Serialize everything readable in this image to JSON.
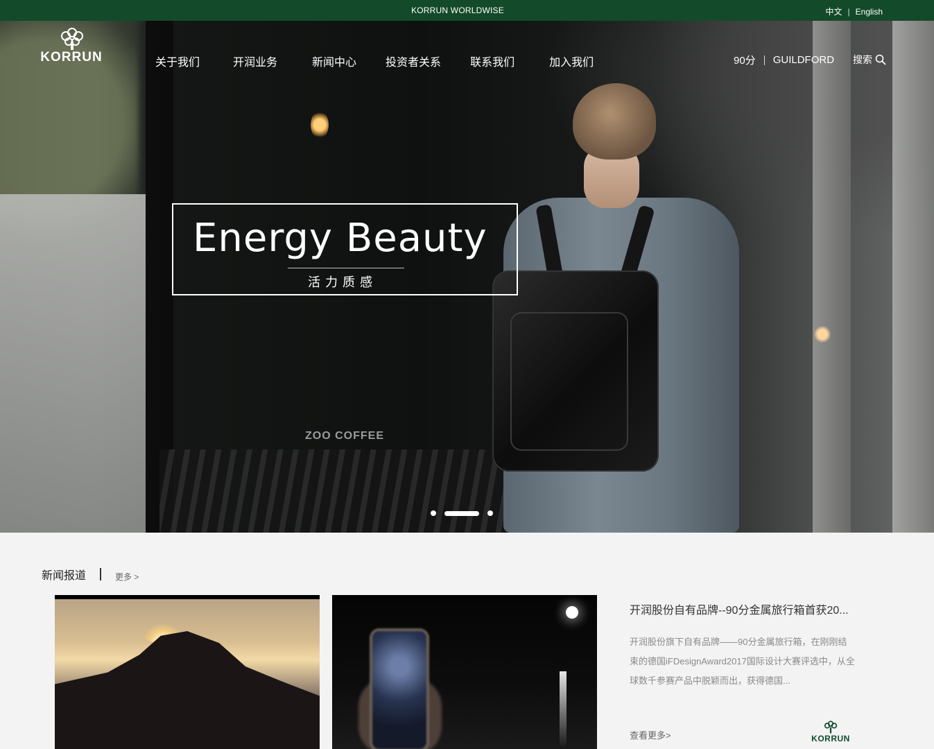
{
  "top_bar": {
    "center_title": "KORRUN WORLDWISE",
    "lang_zh": "中文",
    "lang_sep": "|",
    "lang_en": "English"
  },
  "header": {
    "brand": "KORRUN",
    "nav": [
      {
        "label": "关于我们"
      },
      {
        "label": "开润业务"
      },
      {
        "label": "新闻中心"
      },
      {
        "label": "投资者关系"
      },
      {
        "label": "联系我们"
      },
      {
        "label": "加入我们"
      }
    ],
    "brands": [
      {
        "label": "90分"
      },
      {
        "label": "GUILDFORD"
      }
    ],
    "search_label": "搜索"
  },
  "hero": {
    "headline": "Energy Beauty",
    "subheadline": "活力质感",
    "storefront_text": "ZOO COFFEE",
    "slides_total": 3,
    "active_slide": 2
  },
  "news": {
    "section_title": "新闻报道",
    "more_label": "更多 >",
    "article": {
      "title": "开润股份自有品牌--90分金属旅行箱首获20...",
      "body": "开润股份旗下自有品牌——90分金属旅行箱，在刚刚结束的德国iFDesignAward2017国际设计大赛评选中，从全球数千参赛产品中脱颖而出，获得德国...",
      "more_label": "查看更多>",
      "brand": "KORRUN"
    }
  },
  "colors": {
    "brand_green": "#134a2a",
    "white": "#ffffff",
    "page_bg": "#f3f3f3"
  }
}
